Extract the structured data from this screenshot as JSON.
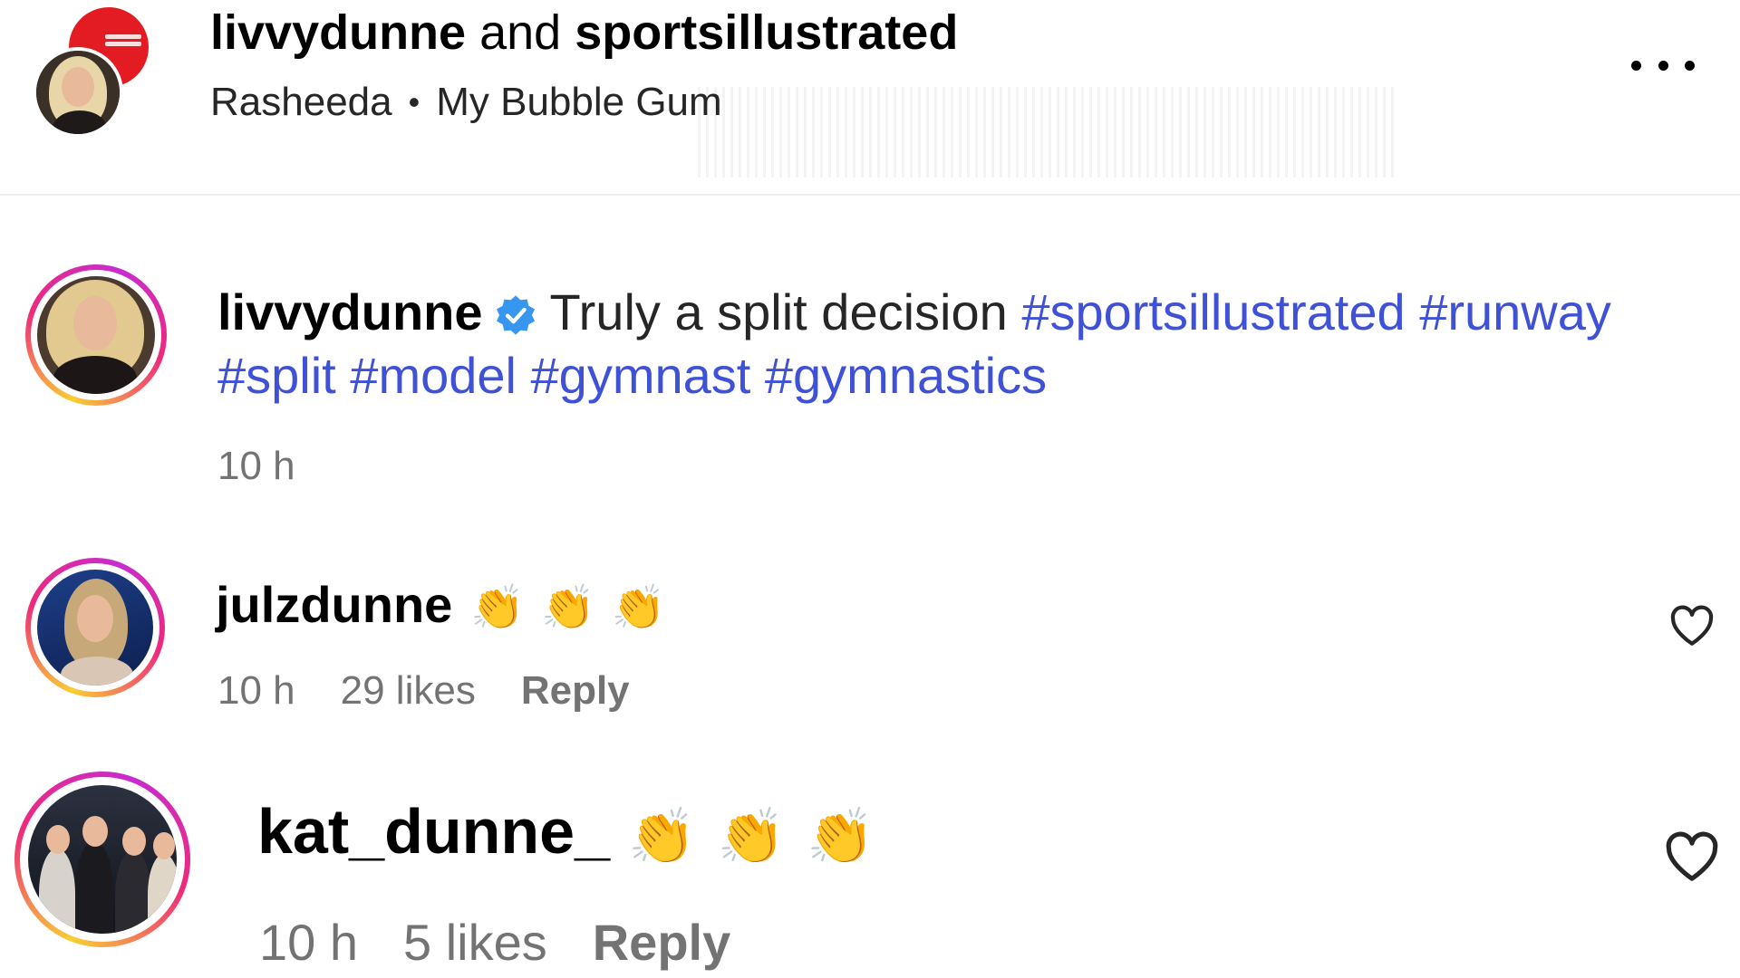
{
  "header": {
    "owner_username": "livvydunne",
    "joiner": "and",
    "collaborator_username": "sportsillustrated",
    "audio_artist": "Rasheeda",
    "audio_separator": "•",
    "audio_track": "My Bubble Gum",
    "more_icon": "more-horizontal-icon"
  },
  "caption": {
    "username": "livvydunne",
    "verified_icon": "verified-badge-icon",
    "text": "Truly a split decision",
    "hashtags": [
      "#sportsillustrated",
      "#runway",
      "#split",
      "#model",
      "#gymnast",
      "#gymnastics"
    ],
    "time": "10 h"
  },
  "comments": [
    {
      "username": "julzdunne",
      "emojis": "👏👏👏",
      "time": "10 h",
      "likes": "29 likes",
      "reply_label": "Reply",
      "like_icon": "heart-outline-icon"
    },
    {
      "username": "kat_dunne_",
      "emojis": "👏👏👏",
      "time": "10 h",
      "likes": "5 likes",
      "reply_label": "Reply",
      "like_icon": "heart-outline-icon"
    }
  ],
  "colors": {
    "hashtag": "#3f51d6",
    "meta_text": "#737373",
    "verified": "#3797f0",
    "brand_red": "#e31b23"
  }
}
